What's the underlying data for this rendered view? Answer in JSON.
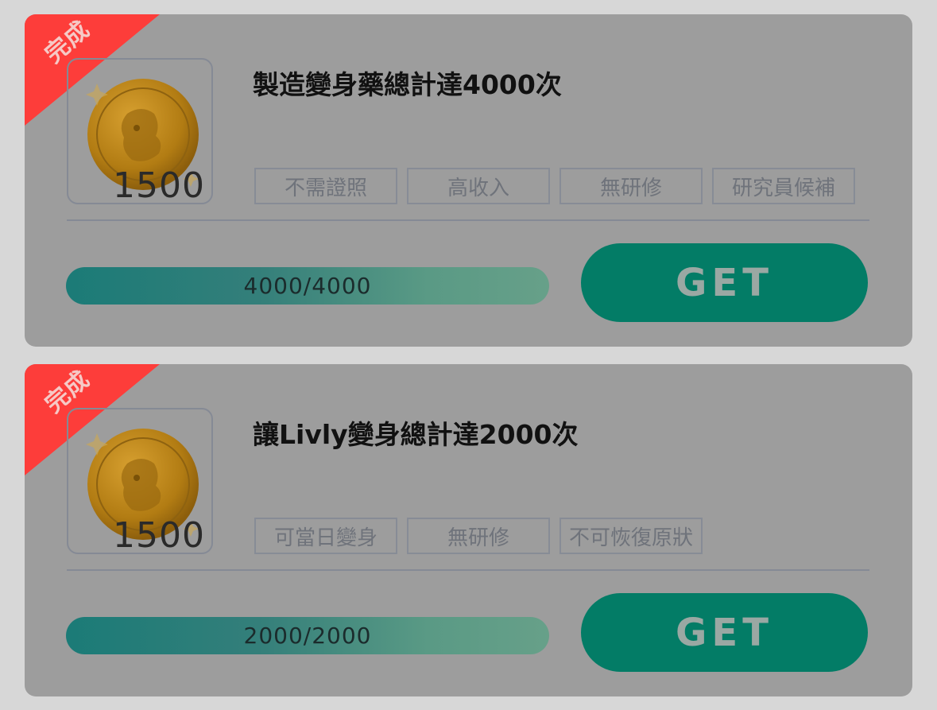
{
  "tasks": [
    {
      "status_label": "完成",
      "title": "製造變身藥總計達4000次",
      "reward_amount": "1500",
      "tags": [
        "不需證照",
        "高收入",
        "無研修",
        "研究員候補"
      ],
      "progress_text": "4000/4000",
      "progress_fraction": 1.0,
      "button_label": "GET"
    },
    {
      "status_label": "完成",
      "title": "讓Livly變身總計達2000次",
      "reward_amount": "1500",
      "tags": [
        "可當日變身",
        "無研修",
        "不可恢復原狀"
      ],
      "progress_text": "2000/2000",
      "progress_fraction": 1.0,
      "button_label": "GET"
    }
  ],
  "colors": {
    "ribbon": "#fd3d3a",
    "button": "#037c66",
    "card": "#9d9d9d",
    "progress_start": "#1b7b77",
    "progress_end": "#67a089"
  },
  "icons": {
    "reward": "gold-coin-icon"
  }
}
